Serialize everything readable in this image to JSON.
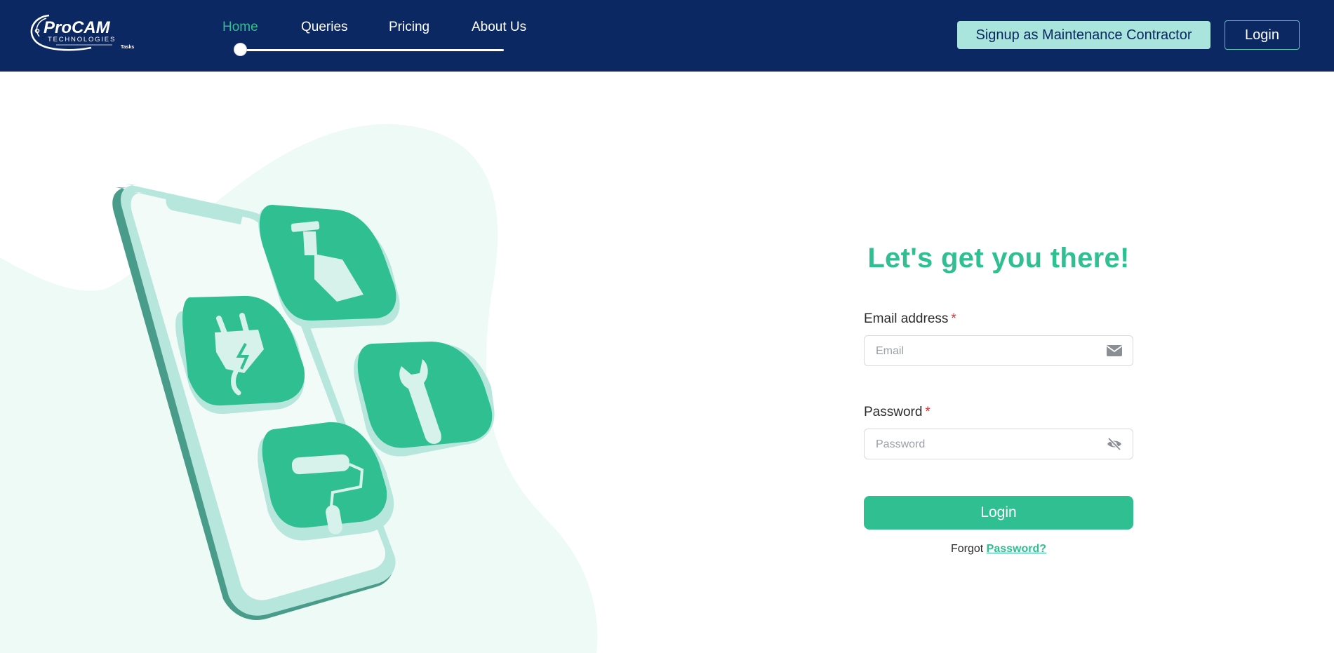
{
  "header": {
    "logo_text": "ProCAM",
    "logo_subtitle": "TECHNOLOGIES",
    "logo_tagline": "Tasks",
    "nav": [
      {
        "label": "Home",
        "active": true
      },
      {
        "label": "Queries",
        "active": false
      },
      {
        "label": "Pricing",
        "active": false
      },
      {
        "label": "About Us",
        "active": false
      }
    ],
    "signup_label": "Signup as Maintenance Contractor",
    "login_label": "Login"
  },
  "form": {
    "heading": "Let's get you there!",
    "email_label": "Email address",
    "email_placeholder": "Email",
    "email_value": "",
    "password_label": "Password",
    "password_placeholder": "Password",
    "password_value": "",
    "required_marker": "*",
    "login_button": "Login",
    "forgot_prefix": "Forgot",
    "forgot_link": "Password?"
  },
  "icons": {
    "email_field": "envelope-icon",
    "password_field": "eye-slash-icon",
    "illustration_tiles": [
      "spray-bottle-icon",
      "electric-plug-icon",
      "wrench-icon",
      "paint-roller-icon"
    ]
  },
  "colors": {
    "header_bg": "#0c2862",
    "accent": "#2fbf91",
    "signup_bg": "#a9e4dd",
    "blob": "#eefaf6",
    "required": "#e03131"
  }
}
